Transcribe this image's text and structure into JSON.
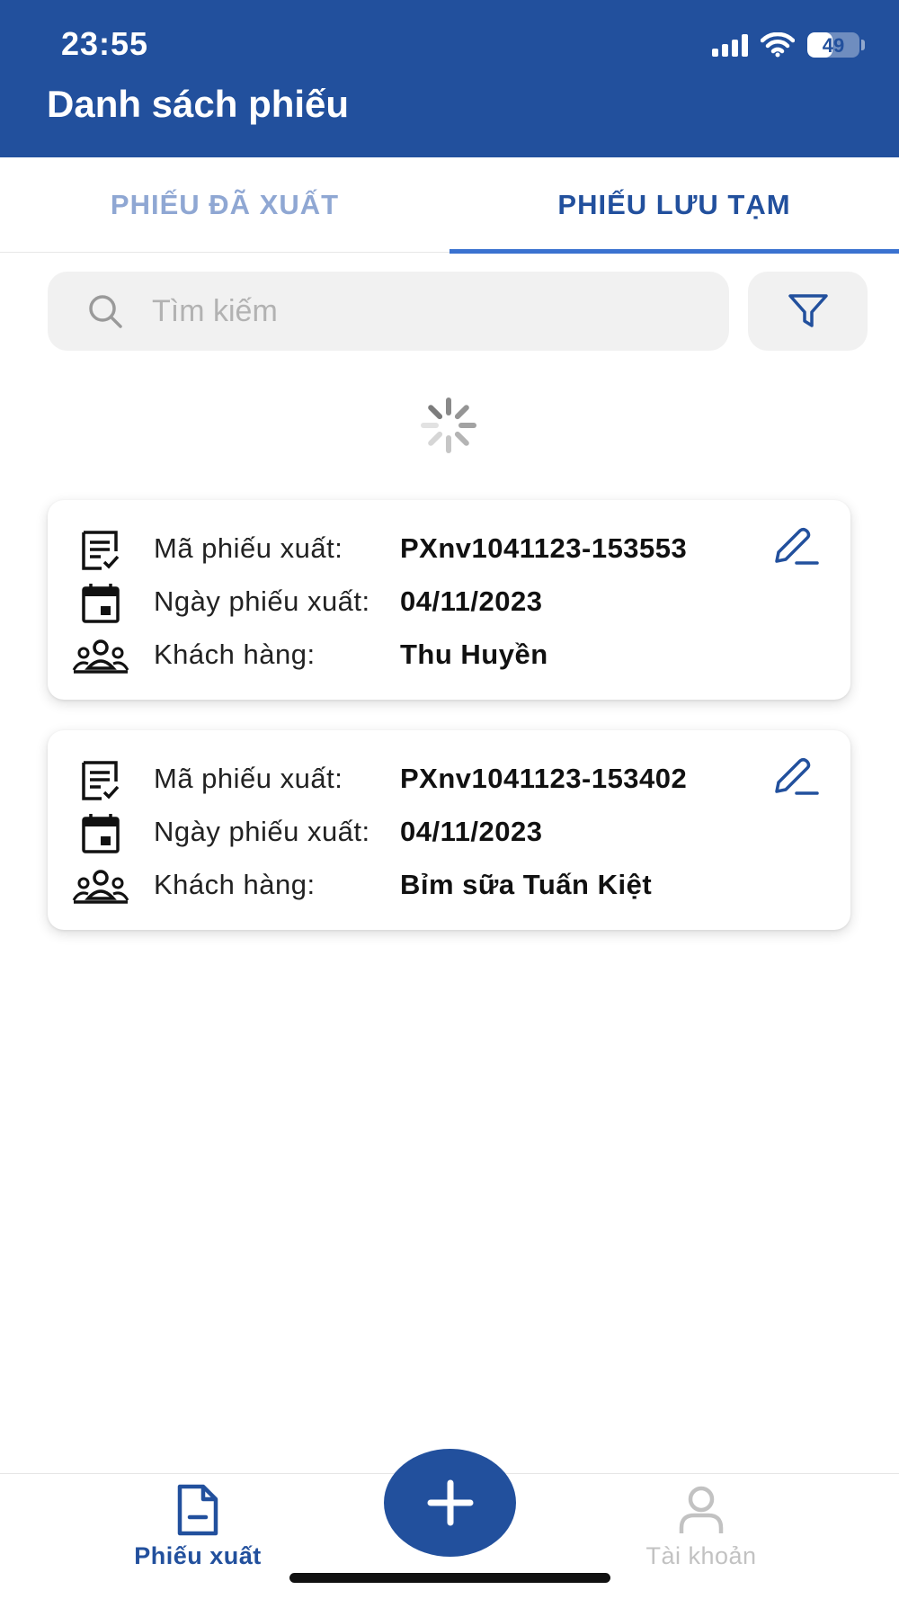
{
  "status_bar": {
    "time": "23:55",
    "battery": "49",
    "battery_level": 0.49
  },
  "header": {
    "title": "Danh sách phiếu"
  },
  "tabs": [
    {
      "label": "PHIẾU ĐÃ XUẤT",
      "active": false
    },
    {
      "label": "PHIẾU LƯU TẠM",
      "active": true
    }
  ],
  "search": {
    "placeholder": "Tìm kiếm",
    "value": ""
  },
  "cards": [
    {
      "code_label": "Mã phiếu xuất:",
      "code": "PXnv1041123-153553",
      "date_label": "Ngày phiếu xuất:",
      "date": "04/11/2023",
      "customer_label": "Khách hàng:",
      "customer": "Thu Huyền"
    },
    {
      "code_label": "Mã phiếu xuất:",
      "code": "PXnv1041123-153402",
      "date_label": "Ngày phiếu xuất:",
      "date": "04/11/2023",
      "customer_label": "Khách hàng:",
      "customer": "Bỉm sữa Tuấn Kiệt"
    }
  ],
  "bottom_nav": {
    "items": [
      {
        "label": "Phiếu xuất",
        "icon": "document-minus-icon",
        "active": true
      },
      {
        "label": "Tài khoản",
        "icon": "user-icon",
        "active": false
      }
    ],
    "fab_icon": "plus-icon"
  },
  "colors": {
    "primary": "#22509d",
    "tab_inactive": "#8fa7d3",
    "tab_indicator": "#3a72d0",
    "search_bg": "#f1f1f1",
    "nav_inactive": "#c2c2c2"
  }
}
